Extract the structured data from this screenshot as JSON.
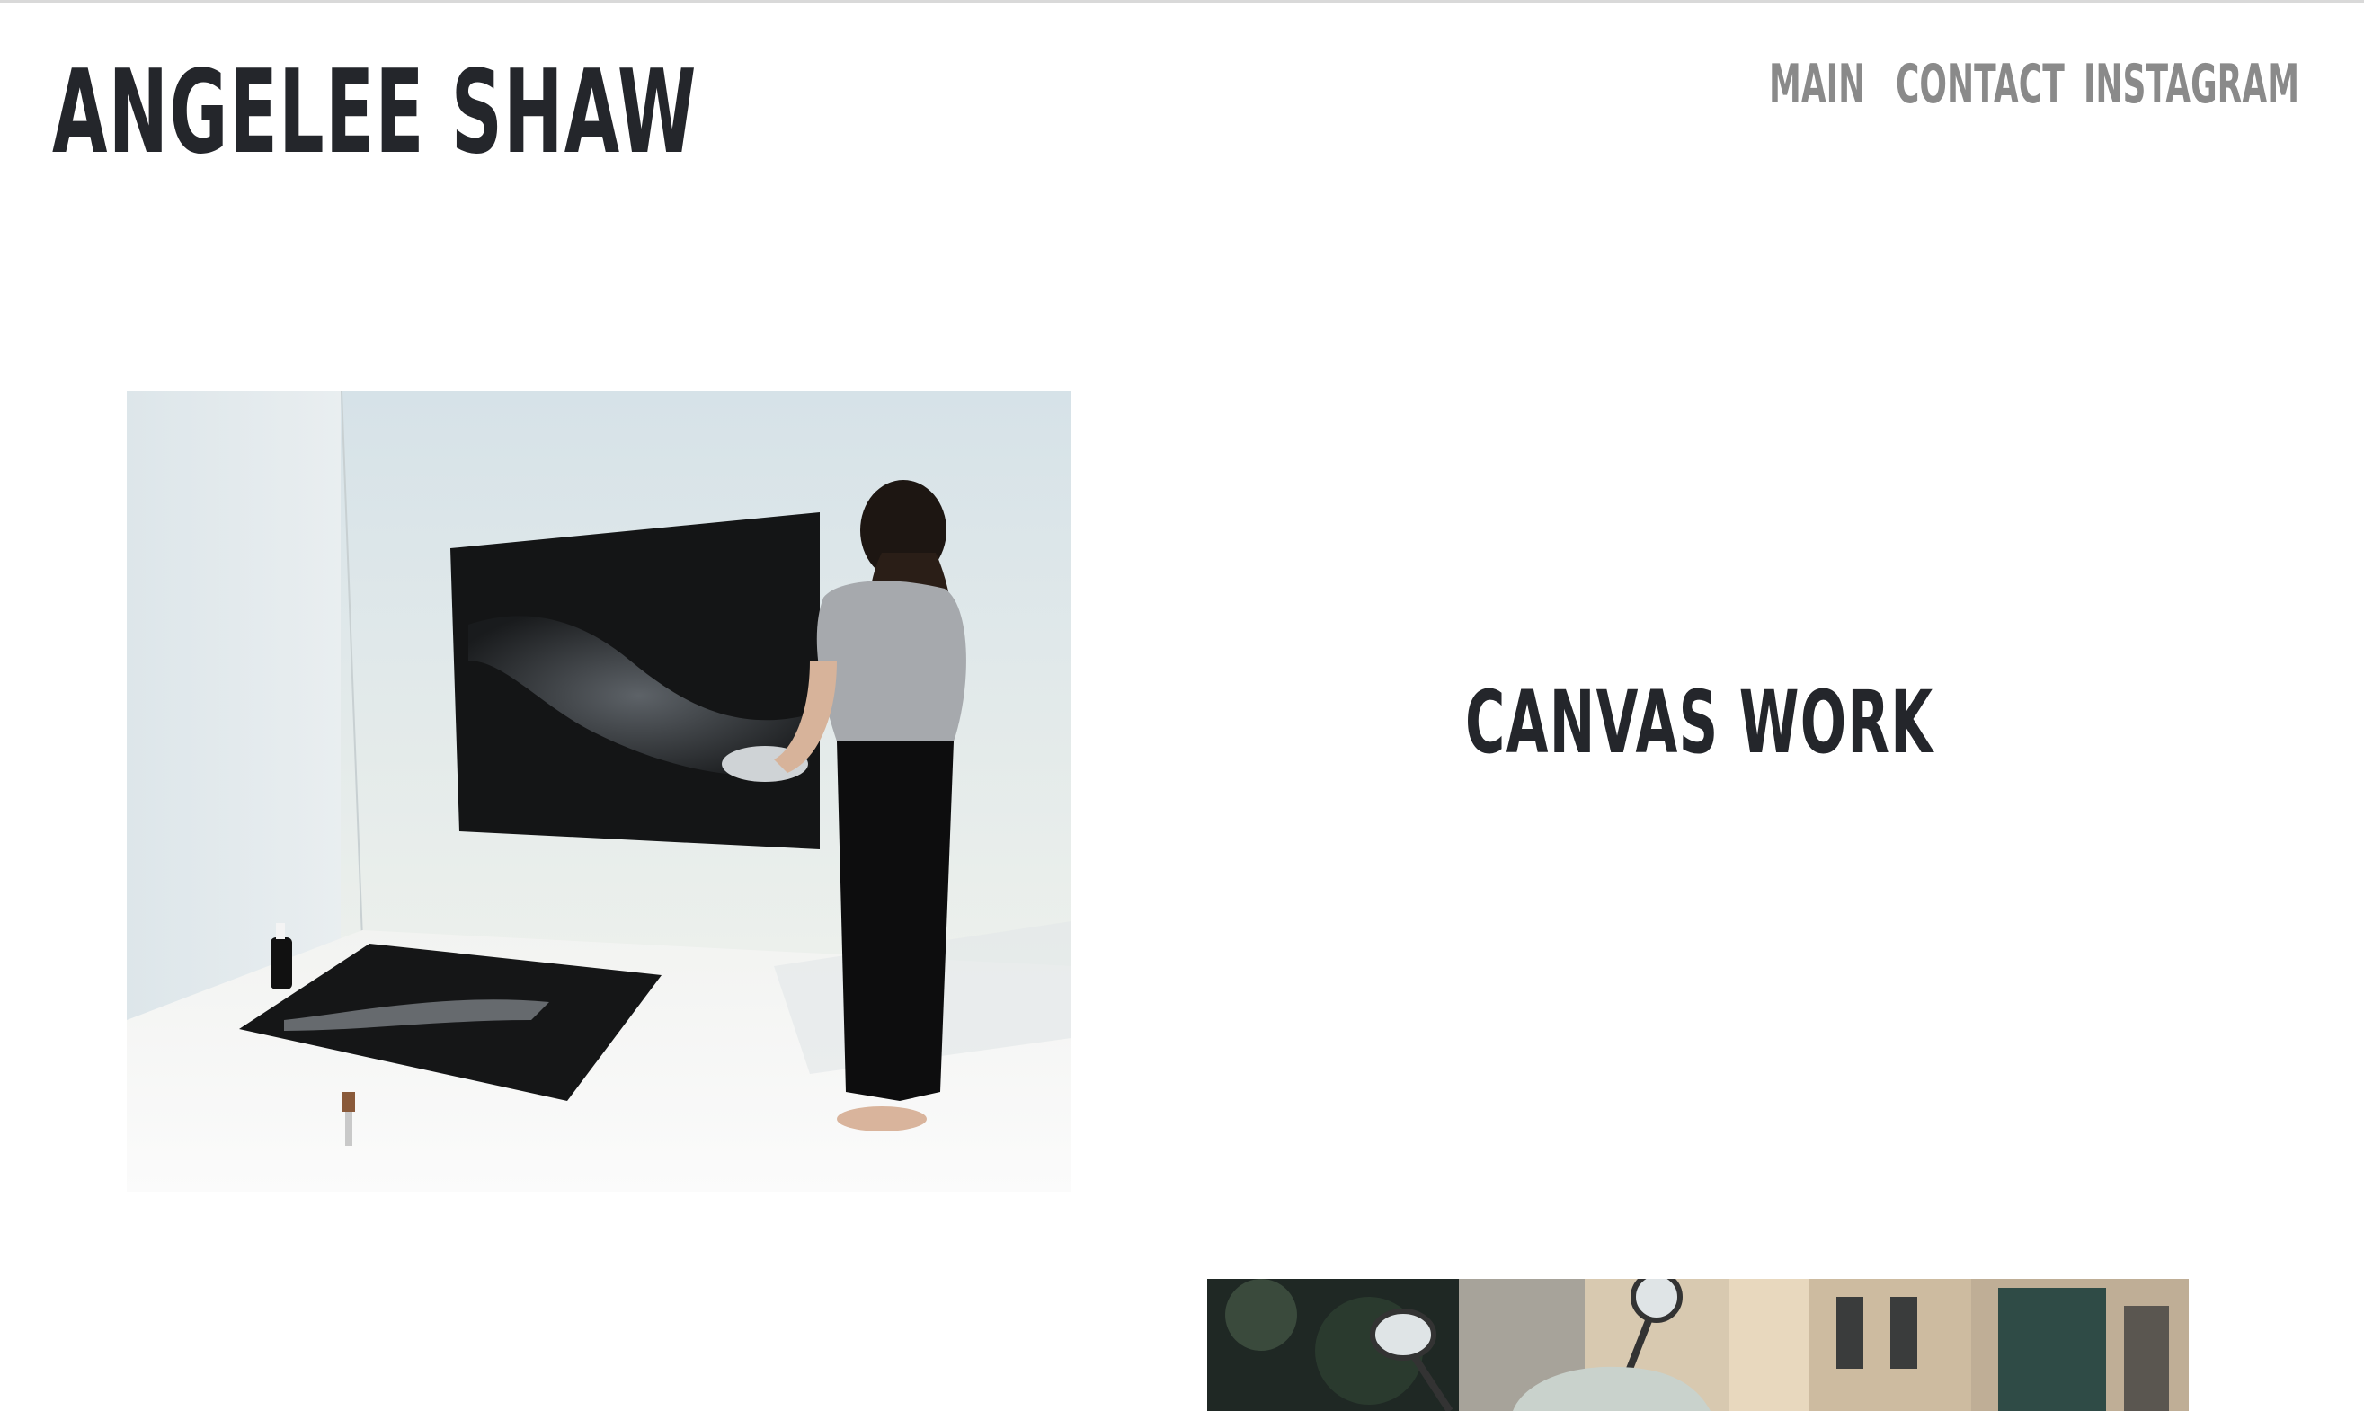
{
  "site": {
    "title": "ANGELEE SHAW"
  },
  "nav": {
    "items": [
      {
        "label": "MAIN"
      },
      {
        "label": "CONTACT"
      },
      {
        "label": "INSTAGRAM"
      }
    ]
  },
  "sections": [
    {
      "heading": "CANVAS WORK",
      "image_subject": "artist painting large black canvas in white studio"
    },
    {
      "heading": "",
      "image_subject": "street with scooter mirrors and building facades"
    }
  ],
  "colors": {
    "text_dark": "#24262b",
    "nav_gray": "#8a8a8a",
    "background": "#ffffff"
  }
}
